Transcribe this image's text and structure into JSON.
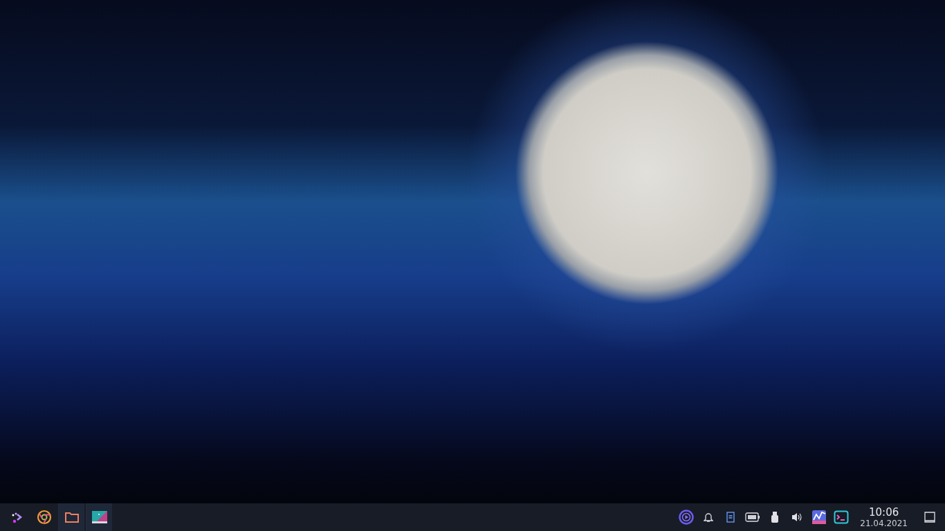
{
  "taskbar": {
    "launchers": [
      {
        "kind": "menu",
        "running": false
      },
      {
        "kind": "browser",
        "running": false
      },
      {
        "kind": "files",
        "running": true
      },
      {
        "kind": "viewer",
        "running": true
      }
    ],
    "tray": [
      {
        "kind": "media"
      },
      {
        "kind": "bell"
      },
      {
        "kind": "notes"
      },
      {
        "kind": "battery"
      },
      {
        "kind": "usb"
      },
      {
        "kind": "volume"
      },
      {
        "kind": "monitor"
      },
      {
        "kind": "terminal"
      }
    ],
    "clock": {
      "time": "10:06",
      "date": "21.04.2021"
    }
  }
}
